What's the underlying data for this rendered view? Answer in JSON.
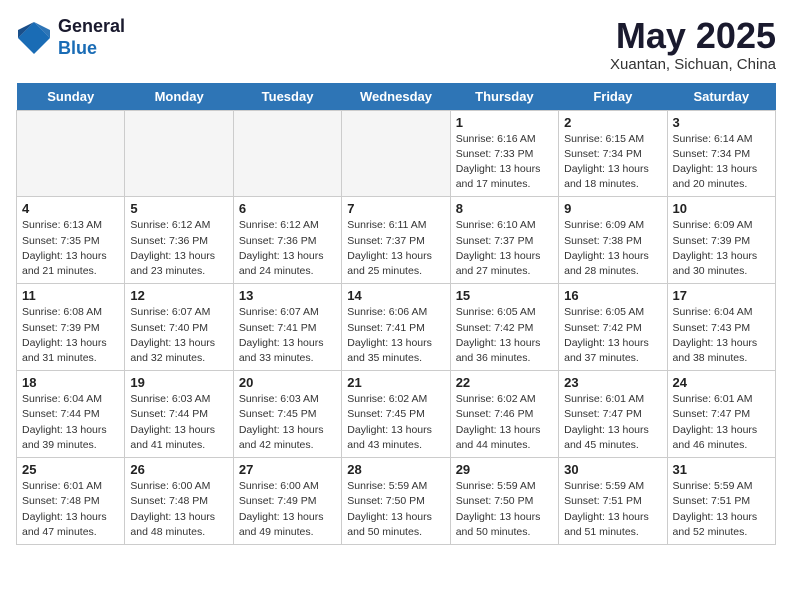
{
  "header": {
    "logo_general": "General",
    "logo_blue": "Blue",
    "month_title": "May 2025",
    "location": "Xuantan, Sichuan, China"
  },
  "weekdays": [
    "Sunday",
    "Monday",
    "Tuesday",
    "Wednesday",
    "Thursday",
    "Friday",
    "Saturday"
  ],
  "weeks": [
    [
      {
        "day": "",
        "empty": true
      },
      {
        "day": "",
        "empty": true
      },
      {
        "day": "",
        "empty": true
      },
      {
        "day": "",
        "empty": true
      },
      {
        "day": "1",
        "sunrise": "6:16 AM",
        "sunset": "7:33 PM",
        "daylight": "13 hours and 17 minutes."
      },
      {
        "day": "2",
        "sunrise": "6:15 AM",
        "sunset": "7:34 PM",
        "daylight": "13 hours and 18 minutes."
      },
      {
        "day": "3",
        "sunrise": "6:14 AM",
        "sunset": "7:34 PM",
        "daylight": "13 hours and 20 minutes."
      }
    ],
    [
      {
        "day": "4",
        "sunrise": "6:13 AM",
        "sunset": "7:35 PM",
        "daylight": "13 hours and 21 minutes."
      },
      {
        "day": "5",
        "sunrise": "6:12 AM",
        "sunset": "7:36 PM",
        "daylight": "13 hours and 23 minutes."
      },
      {
        "day": "6",
        "sunrise": "6:12 AM",
        "sunset": "7:36 PM",
        "daylight": "13 hours and 24 minutes."
      },
      {
        "day": "7",
        "sunrise": "6:11 AM",
        "sunset": "7:37 PM",
        "daylight": "13 hours and 25 minutes."
      },
      {
        "day": "8",
        "sunrise": "6:10 AM",
        "sunset": "7:37 PM",
        "daylight": "13 hours and 27 minutes."
      },
      {
        "day": "9",
        "sunrise": "6:09 AM",
        "sunset": "7:38 PM",
        "daylight": "13 hours and 28 minutes."
      },
      {
        "day": "10",
        "sunrise": "6:09 AM",
        "sunset": "7:39 PM",
        "daylight": "13 hours and 30 minutes."
      }
    ],
    [
      {
        "day": "11",
        "sunrise": "6:08 AM",
        "sunset": "7:39 PM",
        "daylight": "13 hours and 31 minutes."
      },
      {
        "day": "12",
        "sunrise": "6:07 AM",
        "sunset": "7:40 PM",
        "daylight": "13 hours and 32 minutes."
      },
      {
        "day": "13",
        "sunrise": "6:07 AM",
        "sunset": "7:41 PM",
        "daylight": "13 hours and 33 minutes."
      },
      {
        "day": "14",
        "sunrise": "6:06 AM",
        "sunset": "7:41 PM",
        "daylight": "13 hours and 35 minutes."
      },
      {
        "day": "15",
        "sunrise": "6:05 AM",
        "sunset": "7:42 PM",
        "daylight": "13 hours and 36 minutes."
      },
      {
        "day": "16",
        "sunrise": "6:05 AM",
        "sunset": "7:42 PM",
        "daylight": "13 hours and 37 minutes."
      },
      {
        "day": "17",
        "sunrise": "6:04 AM",
        "sunset": "7:43 PM",
        "daylight": "13 hours and 38 minutes."
      }
    ],
    [
      {
        "day": "18",
        "sunrise": "6:04 AM",
        "sunset": "7:44 PM",
        "daylight": "13 hours and 39 minutes."
      },
      {
        "day": "19",
        "sunrise": "6:03 AM",
        "sunset": "7:44 PM",
        "daylight": "13 hours and 41 minutes."
      },
      {
        "day": "20",
        "sunrise": "6:03 AM",
        "sunset": "7:45 PM",
        "daylight": "13 hours and 42 minutes."
      },
      {
        "day": "21",
        "sunrise": "6:02 AM",
        "sunset": "7:45 PM",
        "daylight": "13 hours and 43 minutes."
      },
      {
        "day": "22",
        "sunrise": "6:02 AM",
        "sunset": "7:46 PM",
        "daylight": "13 hours and 44 minutes."
      },
      {
        "day": "23",
        "sunrise": "6:01 AM",
        "sunset": "7:47 PM",
        "daylight": "13 hours and 45 minutes."
      },
      {
        "day": "24",
        "sunrise": "6:01 AM",
        "sunset": "7:47 PM",
        "daylight": "13 hours and 46 minutes."
      }
    ],
    [
      {
        "day": "25",
        "sunrise": "6:01 AM",
        "sunset": "7:48 PM",
        "daylight": "13 hours and 47 minutes."
      },
      {
        "day": "26",
        "sunrise": "6:00 AM",
        "sunset": "7:48 PM",
        "daylight": "13 hours and 48 minutes."
      },
      {
        "day": "27",
        "sunrise": "6:00 AM",
        "sunset": "7:49 PM",
        "daylight": "13 hours and 49 minutes."
      },
      {
        "day": "28",
        "sunrise": "5:59 AM",
        "sunset": "7:50 PM",
        "daylight": "13 hours and 50 minutes."
      },
      {
        "day": "29",
        "sunrise": "5:59 AM",
        "sunset": "7:50 PM",
        "daylight": "13 hours and 50 minutes."
      },
      {
        "day": "30",
        "sunrise": "5:59 AM",
        "sunset": "7:51 PM",
        "daylight": "13 hours and 51 minutes."
      },
      {
        "day": "31",
        "sunrise": "5:59 AM",
        "sunset": "7:51 PM",
        "daylight": "13 hours and 52 minutes."
      }
    ]
  ]
}
